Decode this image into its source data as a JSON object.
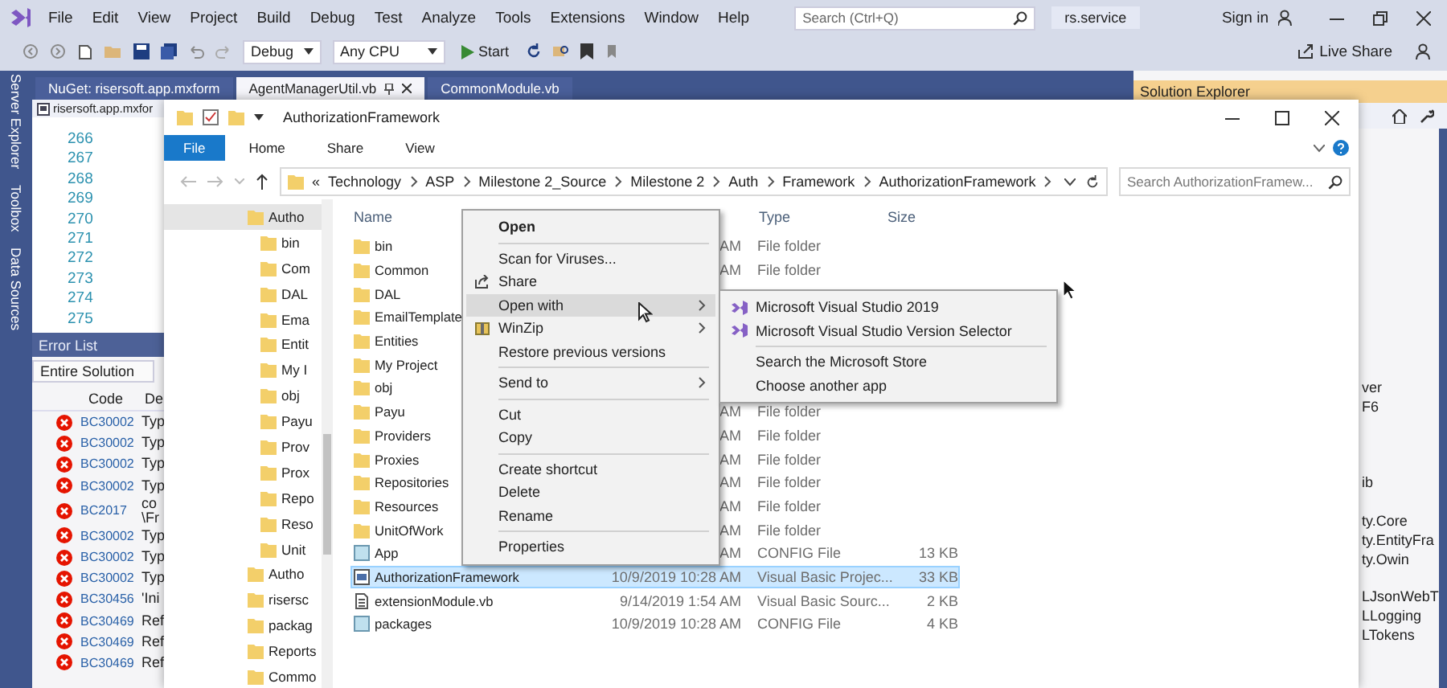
{
  "vs": {
    "menu": [
      "File",
      "Edit",
      "View",
      "Project",
      "Build",
      "Debug",
      "Test",
      "Analyze",
      "Tools",
      "Extensions",
      "Window",
      "Help"
    ],
    "search": {
      "placeholder": "Search (Ctrl+Q)"
    },
    "solution_name": "rs.service",
    "sign_in": "Sign in",
    "toolbar": {
      "configuration": "Debug",
      "platform": "Any CPU",
      "start": "Start",
      "live_share": "Live Share"
    },
    "side_tabs": [
      "Server Explorer",
      "Toolbox",
      "Data Sources"
    ],
    "doc_tabs": [
      {
        "label": "NuGet: risersoft.app.mxform",
        "selected": false
      },
      {
        "label": "AgentManagerUtil.vb",
        "selected": true
      },
      {
        "label": "CommonModule.vb",
        "selected": false
      }
    ],
    "editor": {
      "file": "risersoft.app.mxfor",
      "line_numbers": [
        "266",
        "267",
        "268",
        "269",
        "270",
        "271",
        "272",
        "273",
        "274",
        "275"
      ]
    },
    "error_list": {
      "title": "Error List",
      "scope": "Entire Solution",
      "columns": [
        "Code",
        "De"
      ],
      "rows": [
        {
          "code": "BC30002",
          "description": "Typ"
        },
        {
          "code": "BC30002",
          "description": "Typ"
        },
        {
          "code": "BC30002",
          "description": "Typ"
        },
        {
          "code": "BC30002",
          "description": "Typ"
        },
        {
          "code": "BC2017",
          "description": "co\n\\Fr"
        },
        {
          "code": "BC30002",
          "description": "Typ"
        },
        {
          "code": "BC30002",
          "description": "Typ"
        },
        {
          "code": "BC30002",
          "description": "Typ"
        },
        {
          "code": "BC30456",
          "description": "'Ini"
        },
        {
          "code": "BC30469",
          "description": "Ref"
        },
        {
          "code": "BC30469",
          "description": "Ref"
        },
        {
          "code": "BC30469",
          "description": "Ref"
        }
      ]
    },
    "solution_explorer": {
      "title": "Solution Explorer",
      "groups": [
        [
          "ver",
          "F6"
        ],
        [
          "ib"
        ],
        [
          "ty.Core",
          "ty.EntityFra",
          "ty.Owin"
        ],
        [
          "LJsonWebT",
          "LLogging",
          "LTokens"
        ]
      ]
    }
  },
  "explorer": {
    "title": "AuthorizationFramework",
    "ribbon_tabs": [
      {
        "label": "File",
        "selected": true
      },
      {
        "label": "Home",
        "selected": false
      },
      {
        "label": "Share",
        "selected": false
      },
      {
        "label": "View",
        "selected": false
      }
    ],
    "overflow_mark": "«",
    "breadcrumb": [
      "Technology",
      "ASP",
      "Milestone 2_Source",
      "Milestone 2",
      "Auth",
      "Framework",
      "AuthorizationFramework"
    ],
    "search": {
      "placeholder": "Search AuthorizationFramew..."
    },
    "nav_tree": [
      {
        "label": "Autho",
        "selected": true,
        "children": [
          {
            "label": "bin",
            "selected": false
          },
          {
            "label": "Com",
            "selected": false
          },
          {
            "label": "DAL",
            "selected": false
          },
          {
            "label": "Ema",
            "selected": false
          },
          {
            "label": "Entit",
            "selected": false
          },
          {
            "label": "My I",
            "selected": false
          },
          {
            "label": "obj",
            "selected": false
          },
          {
            "label": "Payu",
            "selected": false
          },
          {
            "label": "Prov",
            "selected": false
          },
          {
            "label": "Prox",
            "selected": false
          },
          {
            "label": "Repo",
            "selected": false
          },
          {
            "label": "Reso",
            "selected": false
          },
          {
            "label": "Unit",
            "selected": false
          }
        ]
      },
      {
        "label": "Autho",
        "selected": false
      },
      {
        "label": "risersc",
        "selected": false
      },
      {
        "label": "packag",
        "selected": false
      },
      {
        "label": "Reports",
        "selected": false
      },
      {
        "label": "Commo",
        "selected": false
      }
    ],
    "columns": [
      "Name",
      "Type",
      "Size"
    ],
    "files": [
      {
        "kind": "folder",
        "name": "bin",
        "date": "AM",
        "type": "File folder",
        "selected": false
      },
      {
        "kind": "folder",
        "name": "Common",
        "date": "AM",
        "type": "File folder",
        "selected": false
      },
      {
        "kind": "folder",
        "name": "DAL",
        "selected": false
      },
      {
        "kind": "folder",
        "name": "EmailTemplate",
        "selected": false
      },
      {
        "kind": "folder",
        "name": "Entities",
        "selected": false
      },
      {
        "kind": "folder",
        "name": "My Project",
        "selected": false
      },
      {
        "kind": "folder",
        "name": "obj",
        "selected": false
      },
      {
        "kind": "folder",
        "name": "Payu",
        "date": "AM",
        "type": "File folder",
        "selected": false
      },
      {
        "kind": "folder",
        "name": "Providers",
        "date": "AM",
        "type": "File folder",
        "selected": false
      },
      {
        "kind": "folder",
        "name": "Proxies",
        "date": "AM",
        "type": "File folder",
        "selected": false
      },
      {
        "kind": "folder",
        "name": "Repositories",
        "date": "AM",
        "type": "File folder",
        "selected": false
      },
      {
        "kind": "folder",
        "name": "Resources",
        "date": "AM",
        "type": "File folder",
        "selected": false
      },
      {
        "kind": "folder",
        "name": "UnitOfWork",
        "date": "AM",
        "type": "File folder",
        "selected": false
      },
      {
        "kind": "config",
        "name": "App",
        "date": "AM",
        "type": "CONFIG File",
        "size": "13 KB",
        "selected": false
      },
      {
        "kind": "project",
        "name": "AuthorizationFramework",
        "date": "10/9/2019 10:28 AM",
        "type": "Visual Basic Projec...",
        "size": "33 KB",
        "selected": true
      },
      {
        "kind": "source",
        "name": "extensionModule.vb",
        "date": "9/14/2019 1:54 AM",
        "type": "Visual Basic Sourc...",
        "size": "2 KB",
        "selected": false
      },
      {
        "kind": "config",
        "name": "packages",
        "date": "10/9/2019 10:28 AM",
        "type": "CONFIG File",
        "size": "4 KB",
        "selected": false
      }
    ]
  },
  "context_menu": {
    "items": [
      {
        "kind": "item",
        "label": "Open",
        "default": true,
        "submenu": false,
        "selected": false
      },
      {
        "kind": "separator"
      },
      {
        "kind": "item",
        "label": "Scan for Viruses...",
        "default": false,
        "submenu": false,
        "selected": false
      },
      {
        "kind": "share",
        "label": "Share",
        "default": false,
        "submenu": false,
        "selected": false
      },
      {
        "kind": "item",
        "label": "Open with",
        "default": false,
        "submenu": true,
        "selected": true
      },
      {
        "kind": "winzip",
        "label": "WinZip",
        "default": false,
        "submenu": true,
        "selected": false
      },
      {
        "kind": "item",
        "label": "Restore previous versions",
        "default": false,
        "submenu": false,
        "selected": false
      },
      {
        "kind": "separator"
      },
      {
        "kind": "item",
        "label": "Send to",
        "default": false,
        "submenu": true,
        "selected": false
      },
      {
        "kind": "separator"
      },
      {
        "kind": "item",
        "label": "Cut",
        "default": false,
        "submenu": false,
        "selected": false
      },
      {
        "kind": "item",
        "label": "Copy",
        "default": false,
        "submenu": false,
        "selected": false
      },
      {
        "kind": "separator"
      },
      {
        "kind": "item",
        "label": "Create shortcut",
        "default": false,
        "submenu": false,
        "selected": false
      },
      {
        "kind": "item",
        "label": "Delete",
        "default": false,
        "submenu": false,
        "selected": false
      },
      {
        "kind": "item",
        "label": "Rename",
        "default": false,
        "submenu": false,
        "selected": false
      },
      {
        "kind": "separator"
      },
      {
        "kind": "item",
        "label": "Properties",
        "default": false,
        "submenu": false,
        "selected": false
      }
    ]
  },
  "submenu": {
    "items": [
      {
        "kind": "app",
        "label": "Microsoft Visual Studio 2019"
      },
      {
        "kind": "app",
        "label": "Microsoft Visual Studio Version Selector"
      },
      {
        "kind": "separator"
      },
      {
        "kind": "item",
        "label": "Search the Microsoft Store"
      },
      {
        "kind": "item",
        "label": "Choose another app"
      }
    ]
  }
}
